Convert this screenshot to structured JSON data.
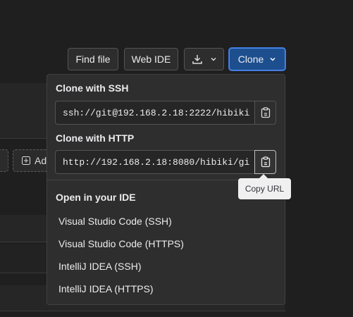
{
  "toolbar": {
    "find_file": "Find file",
    "web_ide": "Web IDE",
    "clone": "Clone"
  },
  "background": {
    "add_chip": "Ad"
  },
  "clone_dropdown": {
    "ssh_title": "Clone with SSH",
    "ssh_url": "ssh://git@192.168.2.18:2222/hibiki",
    "http_title": "Clone with HTTP",
    "http_url": "http://192.168.2.18:8080/hibiki/gi",
    "ide_title": "Open in your IDE",
    "ide_items": [
      "Visual Studio Code (SSH)",
      "Visual Studio Code (HTTPS)",
      "IntelliJ IDEA (SSH)",
      "IntelliJ IDEA (HTTPS)"
    ]
  },
  "tooltip": {
    "text": "Copy URL"
  },
  "icons": {
    "download": "download-icon",
    "chevron": "chevron-down-icon",
    "copy": "clipboard-icon",
    "add": "plus-square-icon"
  }
}
